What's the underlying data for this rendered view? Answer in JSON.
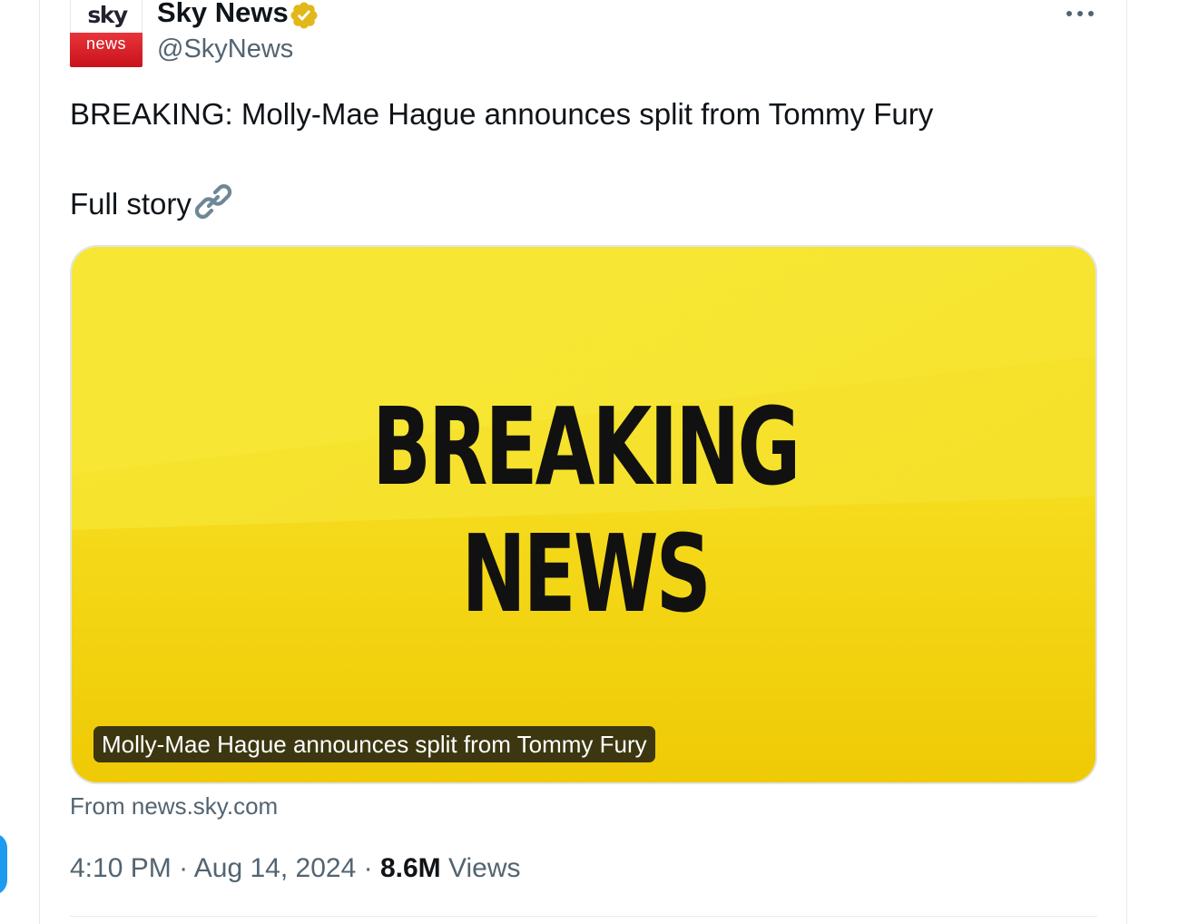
{
  "author": {
    "display_name": "Sky News",
    "handle": "@SkyNews",
    "avatar": {
      "top_text": "sky",
      "bottom_text": "news"
    },
    "verified_icon": "verified-badge-icon",
    "verified_color": "#e2b719"
  },
  "more_icon": "more-horizontal-icon",
  "tweet": {
    "text": "BREAKING: Molly-Mae Hague announces split from Tommy Fury",
    "full_story_label": "Full story",
    "link_icon": "link-icon"
  },
  "card": {
    "image_line1": "BREAKING",
    "image_line2": "NEWS",
    "caption": "Molly-Mae Hague announces split from Tommy Fury",
    "image_color": "#f3d70f",
    "source": "From news.sky.com"
  },
  "meta": {
    "time": "4:10 PM",
    "separator": "·",
    "date": "Aug 14, 2024",
    "views_count": "8.6M",
    "views_label": "Views"
  },
  "colors": {
    "text_primary": "#0f1419",
    "text_secondary": "#536471",
    "accent_blue": "#1d9bf0",
    "brand_red": "#d61b23"
  }
}
